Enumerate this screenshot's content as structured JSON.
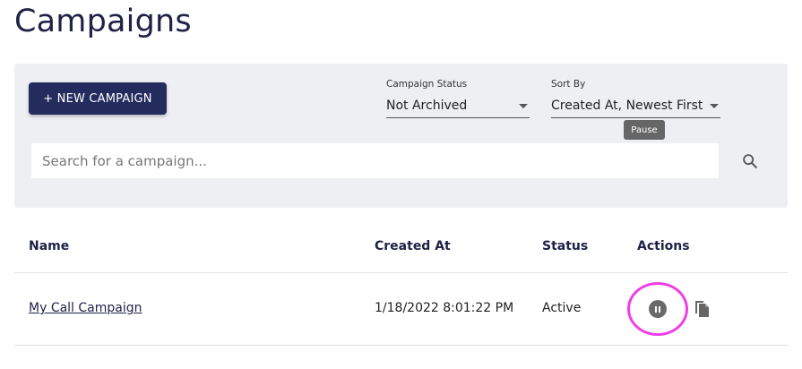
{
  "page": {
    "title": "Campaigns"
  },
  "toolbar": {
    "new_campaign_label": "+ NEW CAMPAIGN",
    "status_filter": {
      "label": "Campaign Status",
      "value": "Not Archived"
    },
    "sort": {
      "label": "Sort By",
      "value": "Created At, Newest First"
    },
    "search": {
      "placeholder": "Search for a campaign..."
    }
  },
  "table": {
    "columns": [
      "Name",
      "Created At",
      "Status",
      "Actions"
    ],
    "rows": [
      {
        "name": "My Call Campaign",
        "created_at": "1/18/2022 8:01:22 PM",
        "status": "Active"
      }
    ]
  },
  "tooltip": {
    "text": "Pause"
  },
  "colors": {
    "primary": "#242c5e",
    "panel_bg": "#eeeff3",
    "highlight_ring": "#f03ee6"
  },
  "icons": [
    "search-icon",
    "pause-icon",
    "copy-icon",
    "dropdown-caret-icon"
  ]
}
